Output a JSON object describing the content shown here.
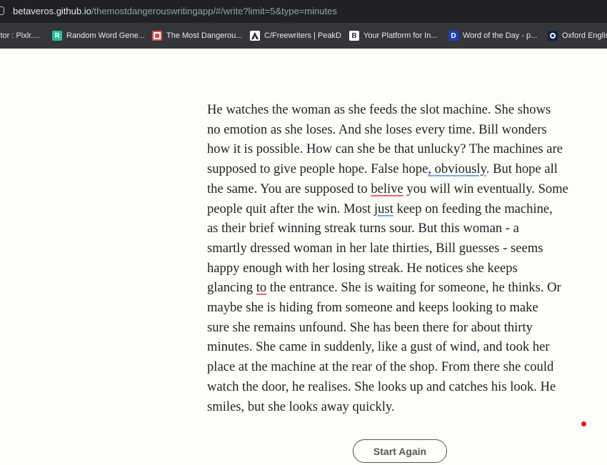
{
  "browser": {
    "url_host": "betaveros.github.io",
    "url_path": "/themostdangerouswritingapp/#/write?limit=5&type=minutes"
  },
  "bookmarks": [
    {
      "label": "itor : Pixlr....",
      "icon": "none",
      "color": ""
    },
    {
      "label": "Random Word Gene...",
      "icon": "r-logo-icon",
      "color": "#2bbf9a",
      "glyph": "R"
    },
    {
      "label": "The Most Dangerou...",
      "icon": "square-logo-icon",
      "color": "#e24a4a"
    },
    {
      "label": "C/Freewriters | PeakD",
      "icon": "peakd-logo-icon",
      "color": "#ffffff"
    },
    {
      "label": "Your Platform for In...",
      "icon": "b-logo-icon",
      "color": "#ffffff",
      "glyph": "B"
    },
    {
      "label": "Word of the Day - p...",
      "icon": "d-logo-icon",
      "color": "#1d3fbb",
      "glyph": "D"
    },
    {
      "label": "Oxford English D...",
      "icon": "oxford-logo-icon",
      "color": "#0b2447"
    }
  ],
  "essay": {
    "lines": [
      "He watches the woman as she feeds the slot machine. She shows",
      "no emotion as she loses. And she loses every time. Bill wonders",
      "how it is possible. How can she be that unlucky? The machines are",
      "supposed to give people hope. False hope, obviously. But hope all",
      "the same. You are supposed to belive you will win eventually. Some",
      "people quit after the win. Most just keep on feeding the machine,",
      "as their brief winning streak turns sour. But this woman - a",
      "smartly dressed woman in her late thirties, Bill guesses - seems",
      "happy enough with her losing streak. He notices she keeps",
      "glancing to the entrance. She is waiting for someone, he thinks. Or",
      "maybe she is hiding from someone and keeps looking to make",
      "sure she remains unfound. She has been there for about thirty",
      "minutes. She came in suddenly, like a gust of wind, and took her",
      "place at the machine at the rear of the shop. From there she could",
      "watch the door, he realises. She looks up and catches his look. He",
      "smiles, but she looks away quickly."
    ],
    "flagged": [
      {
        "line": 3,
        "word": ", obviously",
        "style": "grammar"
      },
      {
        "line": 4,
        "word": "belive",
        "style": "spelling"
      },
      {
        "line": 5,
        "word": "just",
        "style": "grammar"
      },
      {
        "line": 9,
        "word": "to",
        "style": "spelling"
      }
    ]
  },
  "actions": {
    "start_again_label": "Start Again"
  },
  "colors": {
    "page_background": "#fdfdf9",
    "recording_dot": "#e81010",
    "spelling_underline": "#e06b7a",
    "grammar_underline": "#7fa7e8"
  }
}
